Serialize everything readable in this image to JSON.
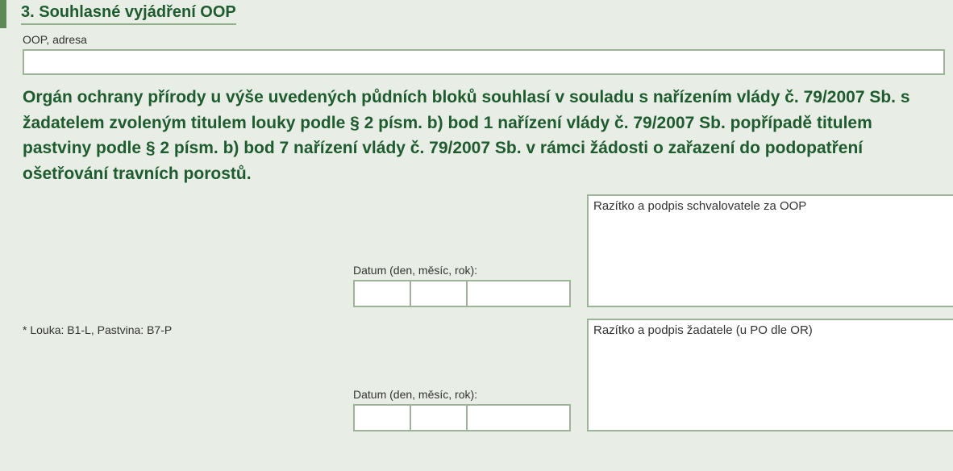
{
  "section": {
    "title": "3. Souhlasné vyjádření OOP"
  },
  "oop_address": {
    "label": "OOP, adresa",
    "value": ""
  },
  "legal_text": "Orgán ochrany přírody u výše uvedených půdních bloků souhlasí v souladu s nařízením vlády č. 79/2007 Sb. s žadatelem zvoleným titulem louky podle § 2 písm. b) bod 1 nařízení vlády č. 79/2007 Sb.  popřípadě titulem pastviny podle § 2 písm. b) bod 7 nařízení vlády č. 79/2007 Sb.  v rámci žádosti o zařazení do podopatření ošetřování travních porostů.",
  "footnote": "* Louka: B1-L, Pastvina: B7-P",
  "date1": {
    "label": "Datum (den, měsíc, rok):",
    "day": "",
    "month": "",
    "year": ""
  },
  "date2": {
    "label": "Datum (den, měsíc, rok):",
    "day": "",
    "month": "",
    "year": ""
  },
  "stamp_approver": {
    "label": "Razítko a podpis schvalovatele za OOP"
  },
  "stamp_applicant": {
    "label": "Razítko a podpis žadatele (u PO dle OR)"
  }
}
